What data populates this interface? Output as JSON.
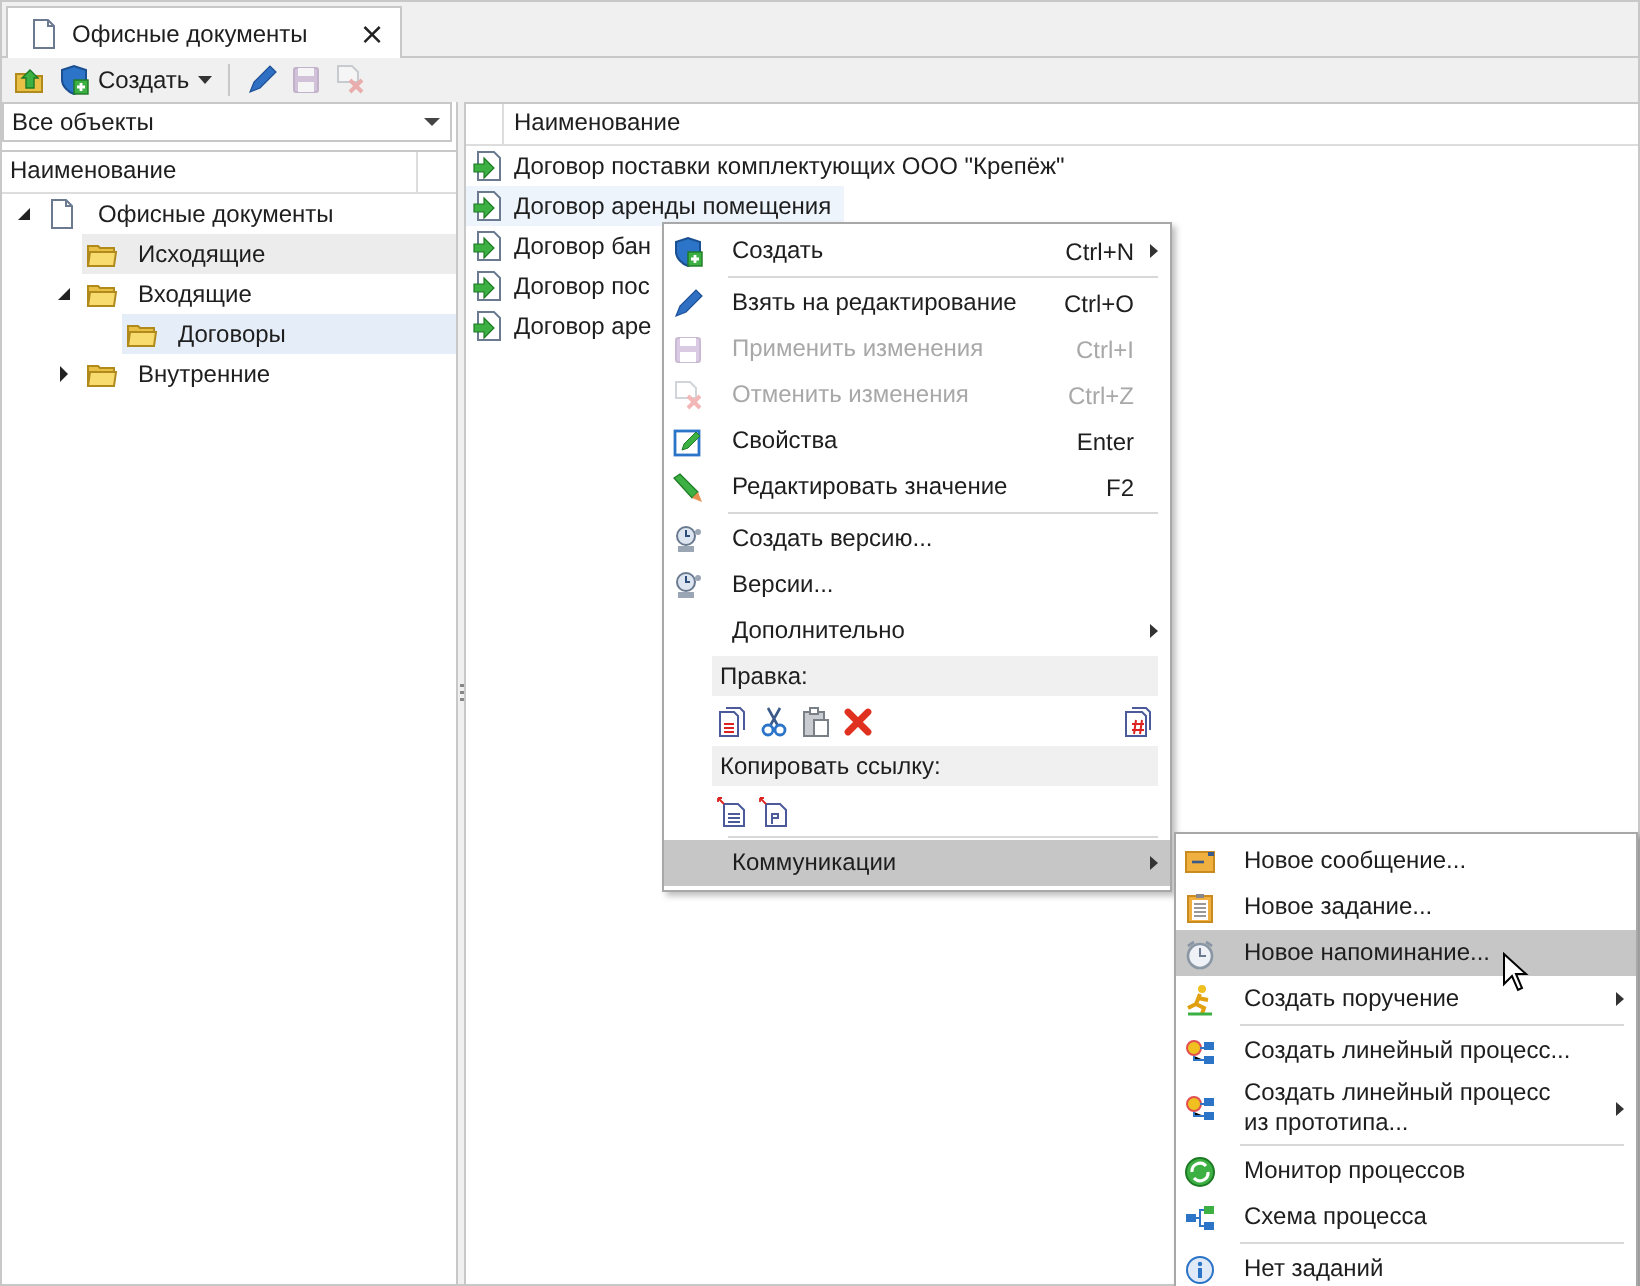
{
  "tab": {
    "title": "Офисные документы",
    "close": "×"
  },
  "toolbar": [
    {
      "kind": "import",
      "disabled": false
    },
    {
      "kind": "create",
      "label": "Создать",
      "disabled": false
    },
    {
      "kind": "separator"
    },
    {
      "kind": "edit",
      "disabled": false
    },
    {
      "kind": "save",
      "disabled": true
    },
    {
      "kind": "cancel",
      "disabled": true
    }
  ],
  "filter": {
    "value": "Все объекты"
  },
  "tree": {
    "column": "Наименование",
    "items": [
      {
        "label": "Офисные документы",
        "kind": "document",
        "expanded": true,
        "selected": false,
        "children": [
          {
            "label": "Исходящие",
            "kind": "folder",
            "selected": false,
            "hovered": true
          },
          {
            "label": "Входящие",
            "kind": "folder",
            "expanded": true,
            "selected": false,
            "children": [
              {
                "label": "Договоры",
                "kind": "folder",
                "selected": true
              }
            ]
          },
          {
            "label": "Внутренние",
            "kind": "folder",
            "expanded": false,
            "selected": false
          }
        ]
      }
    ]
  },
  "list": {
    "column": "Наименование",
    "rows": [
      {
        "label": "Договор поставки комплектующих ООО \"Крепёж\"",
        "selected": false
      },
      {
        "label": "Договор аренды помещения",
        "selected": true
      },
      {
        "label": "Договор бан",
        "selected": false
      },
      {
        "label": "Договор пос",
        "selected": false
      },
      {
        "label": "Договор аре",
        "selected": false
      }
    ]
  },
  "context_menu": {
    "items": [
      {
        "kind": "item",
        "label": "Создать",
        "shortcut": "Ctrl+N",
        "submenu": true,
        "disabled": false,
        "highlighted": false
      },
      {
        "kind": "separator"
      },
      {
        "kind": "item",
        "label": "Взять на редактирование",
        "shortcut": "Ctrl+O",
        "submenu": false,
        "disabled": false,
        "highlighted": false
      },
      {
        "kind": "item",
        "label": "Применить изменения",
        "shortcut": "Ctrl+I",
        "submenu": false,
        "disabled": true,
        "highlighted": false
      },
      {
        "kind": "item",
        "label": "Отменить изменения",
        "shortcut": "Ctrl+Z",
        "submenu": false,
        "disabled": true,
        "highlighted": false
      },
      {
        "kind": "item",
        "label": "Свойства",
        "shortcut": "Enter",
        "submenu": false,
        "disabled": false,
        "highlighted": false
      },
      {
        "kind": "item",
        "label": "Редактировать значение",
        "shortcut": "F2",
        "submenu": false,
        "disabled": false,
        "highlighted": false
      },
      {
        "kind": "separator"
      },
      {
        "kind": "item",
        "label": "Создать версию...",
        "submenu": false,
        "disabled": false,
        "highlighted": false
      },
      {
        "kind": "item",
        "label": "Версии...",
        "submenu": false,
        "disabled": false,
        "highlighted": false
      },
      {
        "kind": "item",
        "label": "Дополнительно",
        "submenu": true,
        "disabled": false,
        "highlighted": false
      },
      {
        "kind": "header",
        "label": "Правка:"
      },
      {
        "kind": "icons"
      },
      {
        "kind": "header",
        "label": "Копировать ссылку:"
      },
      {
        "kind": "icons"
      },
      {
        "kind": "separator"
      },
      {
        "kind": "item",
        "label": "Коммуникации",
        "submenu": true,
        "disabled": false,
        "highlighted": true
      }
    ]
  },
  "submenu": {
    "items": [
      {
        "kind": "item",
        "label": "Новое сообщение...",
        "submenu": false,
        "disabled": false,
        "highlighted": false
      },
      {
        "kind": "item",
        "label": "Новое задание...",
        "submenu": false,
        "disabled": false,
        "highlighted": false
      },
      {
        "kind": "item",
        "label": "Новое напоминание...",
        "submenu": false,
        "disabled": false,
        "highlighted": true
      },
      {
        "kind": "item",
        "label": "Создать поручение",
        "submenu": true,
        "disabled": false,
        "highlighted": false
      },
      {
        "kind": "separator"
      },
      {
        "kind": "item",
        "label": "Создать линейный процесс...",
        "submenu": false,
        "disabled": false,
        "highlighted": false
      },
      {
        "kind": "item",
        "label": "Создать линейный процесс\nиз прототипа...",
        "submenu": true,
        "disabled": false,
        "highlighted": false
      },
      {
        "kind": "separator"
      },
      {
        "kind": "item",
        "label": "Монитор процессов",
        "submenu": false,
        "disabled": false,
        "highlighted": false
      },
      {
        "kind": "item",
        "label": "Схема процесса",
        "submenu": false,
        "disabled": false,
        "highlighted": false
      },
      {
        "kind": "separator"
      },
      {
        "kind": "item",
        "label": "Нет заданий",
        "submenu": false,
        "disabled": false,
        "highlighted": false
      }
    ]
  }
}
